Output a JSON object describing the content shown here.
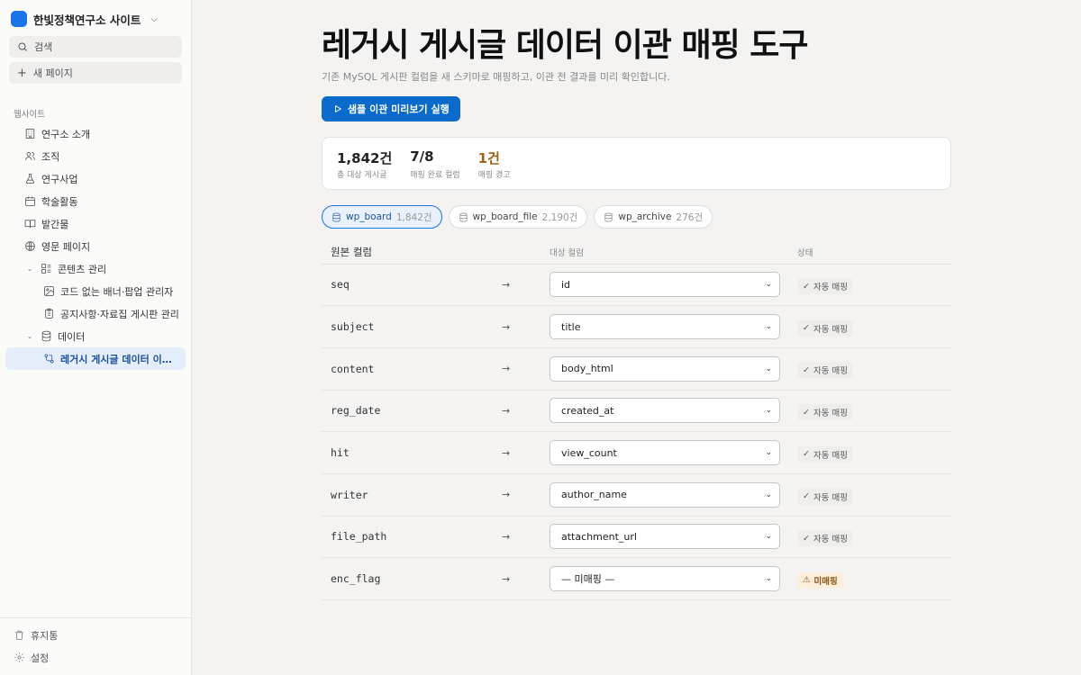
{
  "workspace": {
    "name": "한빛정책연구소 사이트"
  },
  "sidebar": {
    "search_label": "검색",
    "new_page_label": "새 페이지",
    "section_label": "웹사이트",
    "items": [
      {
        "label": "연구소 소개",
        "icon": "building-icon"
      },
      {
        "label": "조직",
        "icon": "users-icon"
      },
      {
        "label": "연구사업",
        "icon": "flask-icon"
      },
      {
        "label": "학술활동",
        "icon": "calendar-icon"
      },
      {
        "label": "발간물",
        "icon": "book-icon"
      },
      {
        "label": "영문 페이지",
        "icon": "globe-icon"
      },
      {
        "label": "콘텐츠 관리",
        "icon": "layout-icon"
      },
      {
        "label": "코드 없는 배너·팝업 관리자",
        "icon": "image-icon"
      },
      {
        "label": "공지사항·자료집 게시판 관리",
        "icon": "clipboard-icon"
      },
      {
        "label": "데이터",
        "icon": "database-icon"
      },
      {
        "label": "레거시 게시글 데이터 이관 ...",
        "icon": "git-branch-icon"
      }
    ],
    "footer": {
      "trash_label": "휴지통",
      "settings_label": "설정"
    }
  },
  "main": {
    "title": "레거시 게시글 데이터 이관 매핑 도구",
    "subtitle": "기존 MySQL 게시판 컬럼을 새 스키마로 매핑하고, 이관 전 결과를 미리 확인합니다.",
    "run_button_label": "샘플 이관 미리보기 실행",
    "stats": [
      {
        "value": "1,842건",
        "label": "총 대상 게시글"
      },
      {
        "value": "7/8",
        "label": "매핑 완료 컬럼"
      },
      {
        "value": "1건",
        "label": "매핑 경고"
      }
    ],
    "tabs": [
      {
        "name": "wp_board",
        "count": "1,842건"
      },
      {
        "name": "wp_board_file",
        "count": "2,190건"
      },
      {
        "name": "wp_archive",
        "count": "276건"
      }
    ],
    "table": {
      "headers": [
        "원본 컬럼",
        "대상 컬럼",
        "상태"
      ],
      "rows": [
        {
          "source": "seq",
          "target": "id",
          "status": "자동 매핑"
        },
        {
          "source": "subject",
          "target": "title",
          "status": "자동 매핑"
        },
        {
          "source": "content",
          "target": "body_html",
          "status": "자동 매핑"
        },
        {
          "source": "reg_date",
          "target": "created_at",
          "status": "자동 매핑"
        },
        {
          "source": "hit",
          "target": "view_count",
          "status": "자동 매핑"
        },
        {
          "source": "writer",
          "target": "author_name",
          "status": "자동 매핑"
        },
        {
          "source": "file_path",
          "target": "attachment_url",
          "status": "자동 매핑"
        },
        {
          "source": "enc_flag",
          "target": "— 미매핑 —",
          "status": "미매핑"
        }
      ]
    }
  },
  "colors": {
    "accent": "#0b6bcb",
    "warning": "#a0611a",
    "active_bg": "#e5eefb"
  }
}
